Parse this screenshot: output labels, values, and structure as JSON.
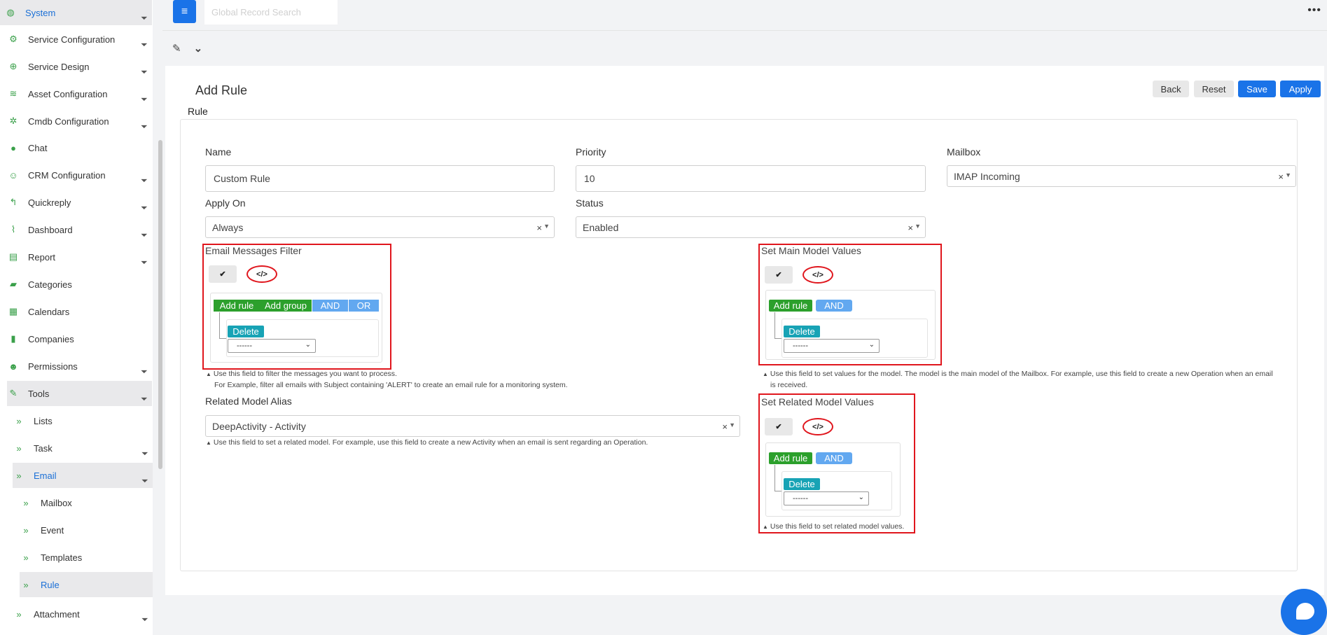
{
  "sidebar": {
    "items": [
      {
        "label": "System",
        "icon": "globe-icon",
        "glyph": "◍"
      },
      {
        "label": "Service Configuration",
        "icon": "cogs-icon",
        "glyph": "⚙"
      },
      {
        "label": "Service Design",
        "icon": "crosshair-icon",
        "glyph": "⊕"
      },
      {
        "label": "Asset Configuration",
        "icon": "wifi-icon",
        "glyph": "≋"
      },
      {
        "label": "Cmdb Configuration",
        "icon": "gear-icon",
        "glyph": "✲"
      },
      {
        "label": "Chat",
        "icon": "comment-icon",
        "glyph": "●"
      },
      {
        "label": "CRM Configuration",
        "icon": "user-check-icon",
        "glyph": "☺"
      },
      {
        "label": "Quickreply",
        "icon": "reply-icon",
        "glyph": "↰"
      },
      {
        "label": "Dashboard",
        "icon": "chart-line-icon",
        "glyph": "⌇"
      },
      {
        "label": "Report",
        "icon": "file-check-icon",
        "glyph": "▤"
      },
      {
        "label": "Categories",
        "icon": "folder-open-icon",
        "glyph": "▰"
      },
      {
        "label": "Calendars",
        "icon": "calendar-icon",
        "glyph": "▦"
      },
      {
        "label": "Companies",
        "icon": "building-icon",
        "glyph": "▮"
      },
      {
        "label": "Permissions",
        "icon": "user-lock-icon",
        "glyph": "☻"
      },
      {
        "label": "Tools",
        "icon": "wrench-icon",
        "glyph": "✎"
      },
      {
        "label": "Lists",
        "icon": "angle-double-right-icon",
        "glyph": "»"
      },
      {
        "label": "Task",
        "icon": "angle-double-right-icon",
        "glyph": "»"
      },
      {
        "label": "Email",
        "icon": "angle-double-right-icon",
        "glyph": "»"
      },
      {
        "label": "Mailbox",
        "icon": "angle-double-right-icon",
        "glyph": "»"
      },
      {
        "label": "Event",
        "icon": "angle-double-right-icon",
        "glyph": "»"
      },
      {
        "label": "Templates",
        "icon": "angle-double-right-icon",
        "glyph": "»"
      },
      {
        "label": "Rule",
        "icon": "angle-double-right-icon",
        "glyph": "»"
      },
      {
        "label": "Attachment",
        "icon": "angle-double-right-icon",
        "glyph": "»"
      }
    ]
  },
  "topbar": {
    "search_placeholder": "Global Record Search",
    "menu_glyph": "≡",
    "more_glyph": "•••"
  },
  "subbar": {
    "edit_glyph": "✎",
    "chevron_glyph": "⌄"
  },
  "page": {
    "title": "Add Rule",
    "section": "Rule"
  },
  "toolbar": {
    "back": "Back",
    "reset": "Reset",
    "save": "Save",
    "apply": "Apply"
  },
  "form": {
    "name_label": "Name",
    "name_value": "Custom Rule",
    "priority_label": "Priority",
    "priority_value": "10",
    "mailbox_label": "Mailbox",
    "mailbox_value": "IMAP Incoming",
    "apply_on_label": "Apply On",
    "apply_on_value": "Always",
    "status_label": "Status",
    "status_value": "Enabled",
    "related_alias_label": "Related Model Alias",
    "related_alias_value": "DeepActivity - Activity",
    "clear_glyph": "×",
    "caret_glyph": "▼",
    "related_hint": "Use this field to set a related model. For example, use this field to create a new Activity when an email is sent regarding an Operation."
  },
  "filter": {
    "title": "Email Messages Filter",
    "hint1": "Use this field to filter the messages you want to process.",
    "hint2": "For Example, filter all emails with Subject containing 'ALERT' to create an email rule for a monitoring system."
  },
  "main_values": {
    "title": "Set Main Model Values",
    "hint1": "Use this field to set values for the model. The model is the main model of the Mailbox. For example, use this field to create a new Operation when an email",
    "hint2": "is received."
  },
  "related_values": {
    "title": "Set Related Model Values",
    "hint1": "Use this field to set related model values."
  },
  "qb": {
    "add_rule": "Add rule",
    "add_group": "Add group",
    "and": "AND",
    "or": "OR",
    "delete": "Delete",
    "select_value": "------",
    "check_glyph": "✔",
    "code_glyph": "</>",
    "hint_glyph": "▲",
    "dd_glyph": "⌄"
  },
  "colors": {
    "accent": "#1a73e8",
    "green": "#2ca02c",
    "teal": "#18a3b5",
    "light_blue": "#62a8f0",
    "red": "#e0161d"
  }
}
